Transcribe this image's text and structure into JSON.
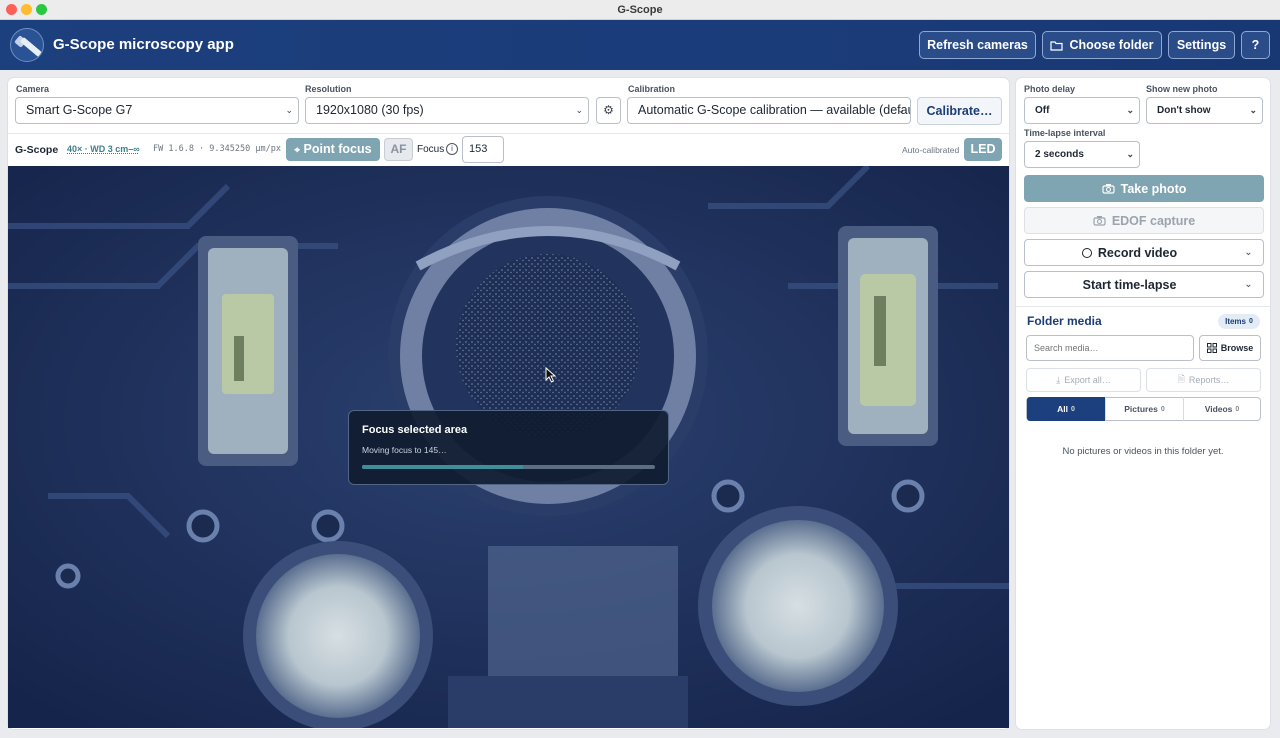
{
  "window": {
    "title": "G-Scope"
  },
  "header": {
    "app_title": "G-Scope microscopy app",
    "buttons": {
      "refresh": "Refresh cameras",
      "choose_folder": "Choose folder",
      "settings": "Settings",
      "help": "?"
    }
  },
  "controls": {
    "camera": {
      "label": "Camera",
      "value": "Smart G-Scope G7"
    },
    "resolution": {
      "label": "Resolution",
      "value": "1920x1080 (30 fps)"
    },
    "calibration": {
      "label": "Calibration",
      "value": "Automatic G-Scope calibration — available (default)",
      "button": "Calibrate…"
    }
  },
  "subbar": {
    "brand": "G-Scope",
    "lens": "40× · WD 3 cm–∞",
    "fw": "FW 1.6.8 · 9.345250 µm/px",
    "point_focus": "Point focus",
    "af": "AF",
    "focus_label": "Focus",
    "focus_value": "153",
    "auto_calibrated": "Auto-calibrated",
    "led": "LED"
  },
  "toast": {
    "title": "Focus selected area",
    "message": "Moving focus to 145…",
    "progress": 0.55
  },
  "right": {
    "photo_delay": {
      "label": "Photo delay",
      "value": "Off"
    },
    "show_new_photo": {
      "label": "Show new photo",
      "value": "Don't show"
    },
    "timelapse_interval": {
      "label": "Time-lapse interval",
      "value": "2 seconds"
    },
    "take_photo": "Take photo",
    "edof": "EDOF capture",
    "record_video": "Record video",
    "start_timelapse": "Start time-lapse",
    "folder_media": {
      "title": "Folder media",
      "items_label": "Items",
      "items_count": "0",
      "search_placeholder": "Search media…",
      "browse": "Browse",
      "export_all": "Export all…",
      "reports": "Reports…",
      "tabs": [
        {
          "label": "All",
          "count": "0"
        },
        {
          "label": "Pictures",
          "count": "0"
        },
        {
          "label": "Videos",
          "count": "0"
        }
      ],
      "empty": "No pictures or videos in this folder yet."
    }
  },
  "colors": {
    "header": "#1c3f7d",
    "accent": "#7fa4b2",
    "progress": "#3f8f9a"
  }
}
